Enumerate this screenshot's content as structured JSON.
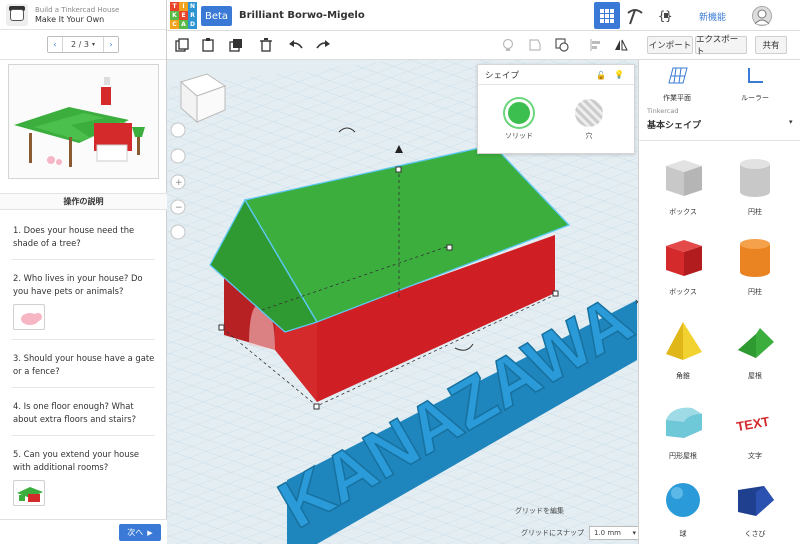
{
  "lesson": {
    "supertitle": "Build a Tinkercad House",
    "title": "Make It Your Own",
    "pager": "2 / 3",
    "instructions_heading": "操作の説明",
    "steps": [
      "1. Does your house need the shade of a tree?",
      "2. Who lives in your house? Do you have pets or animals?",
      "3. Should your house have a gate or a fence?",
      "4. Is one floor enough? What about extra floors and stairs?",
      "5. Can you extend your house with additional rooms?"
    ],
    "next_label": "次へ"
  },
  "topbar": {
    "logo_letters": [
      "T",
      "I",
      "N",
      "K",
      "E",
      "R",
      "C",
      "A",
      "D"
    ],
    "beta": "Beta",
    "project_name": "Brilliant Borwo-Migelo",
    "new_features": "新機能"
  },
  "toolbar": {
    "import": "インポート",
    "export": "エクスポート",
    "share": "共有"
  },
  "shape_panel": {
    "title": "シェイプ",
    "solid": "ソリッド",
    "hole": "穴"
  },
  "viewport": {
    "edit_grid": "グリッドを編集",
    "snap_label": "グリッドにスナップ",
    "snap_value": "1.0 mm",
    "text_3d": "KANAZAWA",
    "colors": {
      "roof": "#3cae3e",
      "wall": "#d42a2c",
      "text": "#2a9bd8",
      "grid": "#c7dde9"
    }
  },
  "right_panel": {
    "workplane": "作業平面",
    "ruler": "ルーラー",
    "library_source": "Tinkercad",
    "library_name": "基本シェイプ",
    "shapes": [
      {
        "label": "ボックス",
        "icon": "box-hole-icon"
      },
      {
        "label": "円柱",
        "icon": "cylinder-hole-icon"
      },
      {
        "label": "ボックス",
        "icon": "box-red-icon"
      },
      {
        "label": "円柱",
        "icon": "cylinder-orange-icon"
      },
      {
        "label": "角錐",
        "icon": "pyramid-icon"
      },
      {
        "label": "屋根",
        "icon": "roof-icon"
      },
      {
        "label": "円形屋根",
        "icon": "round-roof-icon"
      },
      {
        "label": "文字",
        "icon": "text-icon"
      },
      {
        "label": "球",
        "icon": "sphere-icon"
      },
      {
        "label": "くさび",
        "icon": "wedge-icon"
      }
    ]
  }
}
